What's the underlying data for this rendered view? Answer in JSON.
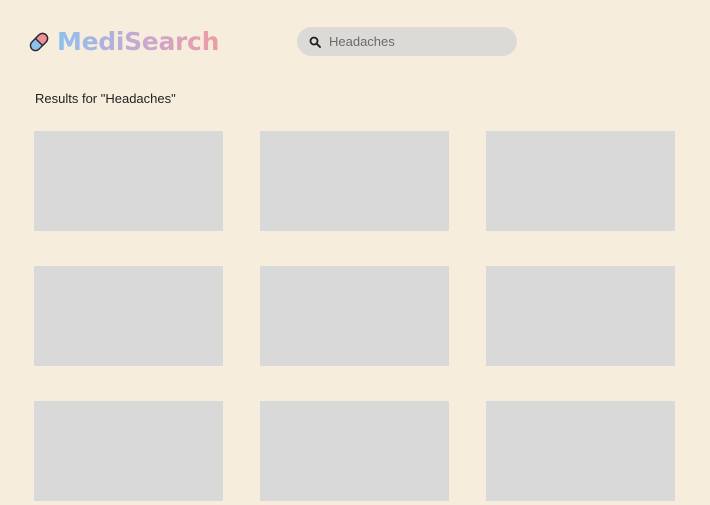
{
  "header": {
    "brand": "MediSearch",
    "logo_icon": "pill-icon",
    "colors": {
      "background": "#f6eddd",
      "brand_gradient_start": "#8ec0ee",
      "brand_gradient_end": "#ef9ba5",
      "search_background": "#dcdad6",
      "card_placeholder": "#d9d9d9"
    }
  },
  "search": {
    "icon": "search-icon",
    "value": "",
    "placeholder": "Headaches"
  },
  "results": {
    "heading": "Results for \"Headaches\"",
    "cards": [
      {
        "label": ""
      },
      {
        "label": ""
      },
      {
        "label": ""
      },
      {
        "label": ""
      },
      {
        "label": ""
      },
      {
        "label": ""
      },
      {
        "label": ""
      },
      {
        "label": ""
      },
      {
        "label": ""
      }
    ]
  }
}
